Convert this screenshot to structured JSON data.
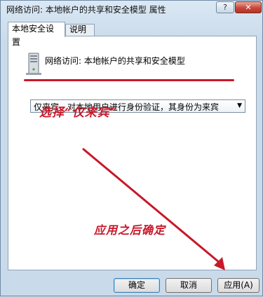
{
  "window": {
    "title": "网络访问: 本地帐户的共享和安全模型 属性",
    "help_label": "?",
    "close_label": "✕"
  },
  "tabs": [
    {
      "label": "本地安全设置",
      "active": true
    },
    {
      "label": "说明",
      "active": false
    }
  ],
  "policy": {
    "icon": "computer-icon",
    "title": "网络访问: 本地帐户的共享和安全模型"
  },
  "dropdown": {
    "selected": "仅来宾 - 对本地用户进行身份验证，其身份为来宾",
    "arrow": "▼"
  },
  "annotations": {
    "note1": "选择“仅来宾”",
    "note2": "应用之后确定",
    "color": "#c8182a"
  },
  "buttons": {
    "ok": "确定",
    "cancel": "取消",
    "apply": "应用(A)"
  }
}
